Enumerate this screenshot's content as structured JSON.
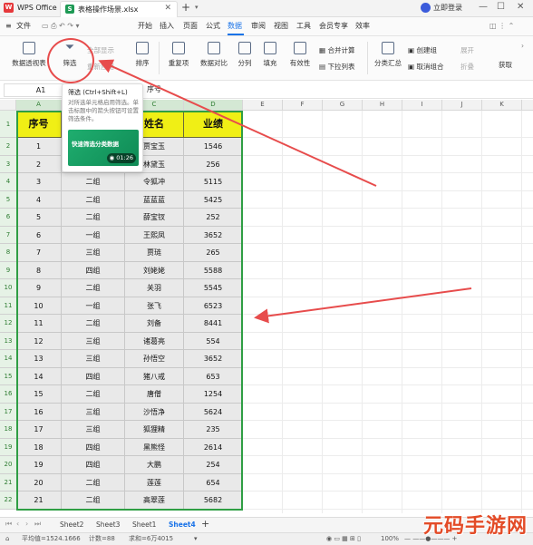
{
  "titlebar": {
    "app_name": "WPS Office",
    "file_name": "表格操作场景.xlsx",
    "login_label": "立即登录"
  },
  "menubar": {
    "items": [
      "文件",
      "开始",
      "插入",
      "页面",
      "公式",
      "数据",
      "审阅",
      "视图",
      "工具",
      "会员专享",
      "效率"
    ],
    "active": "数据"
  },
  "ribbon": {
    "pivot": "数据透视表",
    "filter": "筛选",
    "show_all": "全部显示",
    "reapply": "重新应用",
    "sort": "排序",
    "duplicates": "重复项",
    "compare": "数据对比",
    "split": "分列",
    "fill": "填充",
    "validity": "有效性",
    "consolidate": "合并计算",
    "dropdown": "下拉列表",
    "subtotal": "分类汇总",
    "group": "创建组",
    "ungroup": "取消组合",
    "expand": "展开",
    "collapse": "折叠",
    "get": "获取"
  },
  "formulabar": {
    "name_box": "A1",
    "formula": "序号"
  },
  "tooltip": {
    "title": "筛选 (Ctrl+Shift+L)",
    "description": "对所选单元格启用筛选。单击标题中的箭头按钮可设置筛选条件。",
    "video_title": "快速筛选分类数据",
    "video_time": "01:26"
  },
  "sheet": {
    "columns": [
      "A",
      "B",
      "C",
      "D",
      "E",
      "F",
      "G",
      "H",
      "I",
      "J",
      "K"
    ],
    "headers": [
      "序号",
      "组别",
      "姓名",
      "业绩"
    ],
    "rows": [
      [
        "1",
        "一组",
        "贾宝玉",
        "1546"
      ],
      [
        "2",
        "一组",
        "林黛玉",
        "256"
      ],
      [
        "3",
        "二组",
        "令狐冲",
        "5115"
      ],
      [
        "4",
        "二组",
        "蓝蓝蓝",
        "5425"
      ],
      [
        "5",
        "二组",
        "薛宝钗",
        "252"
      ],
      [
        "6",
        "一组",
        "王熙凤",
        "3652"
      ],
      [
        "7",
        "三组",
        "贾琏",
        "265"
      ],
      [
        "8",
        "四组",
        "刘姥姥",
        "5588"
      ],
      [
        "9",
        "二组",
        "关羽",
        "5545"
      ],
      [
        "10",
        "一组",
        "张飞",
        "6523"
      ],
      [
        "11",
        "二组",
        "刘备",
        "8441"
      ],
      [
        "12",
        "三组",
        "诸葛亮",
        "554"
      ],
      [
        "13",
        "三组",
        "孙悟空",
        "3652"
      ],
      [
        "14",
        "四组",
        "猪八戒",
        "653"
      ],
      [
        "15",
        "二组",
        "唐僧",
        "1254"
      ],
      [
        "16",
        "三组",
        "沙悟净",
        "5624"
      ],
      [
        "17",
        "三组",
        "狐狸精",
        "235"
      ],
      [
        "18",
        "四组",
        "黑熊怪",
        "2614"
      ],
      [
        "19",
        "四组",
        "大鹏",
        "254"
      ],
      [
        "20",
        "二组",
        "莲莲",
        "654"
      ],
      [
        "21",
        "二组",
        "高翠莲",
        "5682"
      ]
    ],
    "row_numbers": [
      "1",
      "2",
      "3",
      "4",
      "5",
      "6",
      "7",
      "8",
      "9",
      "10",
      "11",
      "12",
      "13",
      "14",
      "15",
      "16",
      "17",
      "18",
      "19",
      "20",
      "21",
      "22"
    ]
  },
  "sheettabs": {
    "tabs": [
      "Sheet2",
      "Sheet3",
      "Sheet1",
      "Sheet4"
    ],
    "active": "Sheet4"
  },
  "statusbar": {
    "average": "平均值=1524.1666",
    "count": "计数=88",
    "sum": "求和=6万4015",
    "zoom": "100%"
  },
  "watermark": "元码手游网",
  "colors": {
    "header_fill": "#f0ef15",
    "data_fill": "#e9e9e9",
    "selection": "#2f9e44",
    "annotation": "#e74c4c",
    "accent": "#1a73e8"
  }
}
